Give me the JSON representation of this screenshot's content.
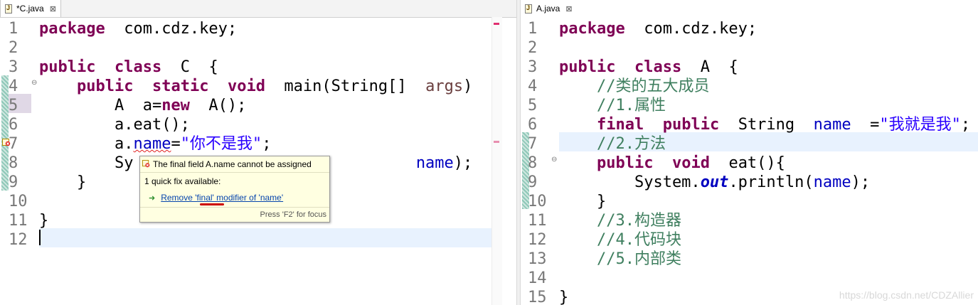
{
  "left_editor": {
    "tab": {
      "label": "*C.java",
      "close": "⊠"
    },
    "line_numbers": [
      "1",
      "2",
      "3",
      "4",
      "5",
      "6",
      "7",
      "8",
      "9",
      "10",
      "11",
      "12"
    ],
    "lines": [
      [
        [
          "kw",
          "package"
        ],
        [
          "",
          "  com.cdz.key;"
        ]
      ],
      [],
      [
        [
          "kw",
          "public"
        ],
        [
          "",
          "  "
        ],
        [
          "kw",
          "class"
        ],
        [
          "",
          "  C  {"
        ]
      ],
      [
        [
          "",
          "    "
        ],
        [
          "kw",
          "public"
        ],
        [
          "",
          "  "
        ],
        [
          "kw",
          "static"
        ],
        [
          "",
          "  "
        ],
        [
          "kw",
          "void"
        ],
        [
          "",
          "  main(String[]  "
        ],
        [
          "arg",
          "args"
        ],
        [
          "",
          ")  {"
        ]
      ],
      [
        [
          "",
          "        A  a="
        ],
        [
          "kw",
          "new"
        ],
        [
          "",
          "  A();"
        ]
      ],
      [
        [
          "",
          "        a."
        ],
        [
          "",
          "eat();"
        ]
      ],
      [
        [
          "",
          "        a."
        ],
        [
          "fldsq",
          "name"
        ],
        [
          "",
          "="
        ],
        [
          "str",
          "\"你不是我\""
        ],
        [
          "",
          ";"
        ]
      ],
      [
        [
          "",
          "        Sy"
        ],
        [
          "",
          "                              "
        ],
        [
          "fld",
          "name"
        ],
        [
          "",
          ");"
        ]
      ],
      [
        [
          "",
          "    }"
        ]
      ],
      [],
      [
        [
          "",
          "}"
        ]
      ],
      []
    ]
  },
  "right_editor": {
    "tab": {
      "label": "A.java",
      "close": "⊠"
    },
    "line_numbers": [
      "1",
      "2",
      "3",
      "4",
      "5",
      "6",
      "7",
      "8",
      "9",
      "10",
      "11",
      "12",
      "13",
      "14",
      "15"
    ],
    "lines": [
      [
        [
          "kw",
          "package"
        ],
        [
          "",
          "  com.cdz.key;"
        ]
      ],
      [],
      [
        [
          "kw",
          "public"
        ],
        [
          "",
          "  "
        ],
        [
          "kw",
          "class"
        ],
        [
          "",
          "  A  {"
        ]
      ],
      [
        [
          "",
          "    "
        ],
        [
          "cmt",
          "//类的五大成员"
        ]
      ],
      [
        [
          "",
          "    "
        ],
        [
          "cmt",
          "//1.属性"
        ]
      ],
      [
        [
          "",
          "    "
        ],
        [
          "kw",
          "final"
        ],
        [
          "",
          "  "
        ],
        [
          "kw",
          "public"
        ],
        [
          "",
          "  String  "
        ],
        [
          "fld",
          "name"
        ],
        [
          "",
          "  ="
        ],
        [
          "str",
          "\"我就是我\""
        ],
        [
          "",
          ";"
        ]
      ],
      [
        [
          "",
          "    "
        ],
        [
          "cmt",
          "//2.方法"
        ]
      ],
      [
        [
          "",
          "    "
        ],
        [
          "kw",
          "public"
        ],
        [
          "",
          "  "
        ],
        [
          "kw",
          "void"
        ],
        [
          "",
          "  eat(){"
        ]
      ],
      [
        [
          "",
          "        System."
        ],
        [
          "sfld",
          "out"
        ],
        [
          "",
          ".println("
        ],
        [
          "fld",
          "name"
        ],
        [
          "",
          ");"
        ]
      ],
      [
        [
          "",
          "    }"
        ]
      ],
      [
        [
          "",
          "    "
        ],
        [
          "cmt",
          "//3.构造器"
        ]
      ],
      [
        [
          "",
          "    "
        ],
        [
          "cmt",
          "//4.代码块"
        ]
      ],
      [
        [
          "",
          "    "
        ],
        [
          "cmt",
          "//5.内部类"
        ]
      ],
      [],
      [
        [
          "",
          "}"
        ]
      ]
    ]
  },
  "quickfix": {
    "title": "The final field A.name cannot be assigned",
    "subtitle": "1 quick fix available:",
    "fix_label": "Remove 'final' modifier of 'name'",
    "footer": "Press 'F2' for focus"
  },
  "watermark": "https://blog.csdn.net/CDZAllier",
  "colors": {
    "keyword": "#7f0055",
    "field": "#0000c0",
    "string": "#2a00ff",
    "comment": "#3f7f5f",
    "current_line": "#e8f2fe",
    "popup_bg": "#ffffe1",
    "error": "#e02020"
  }
}
